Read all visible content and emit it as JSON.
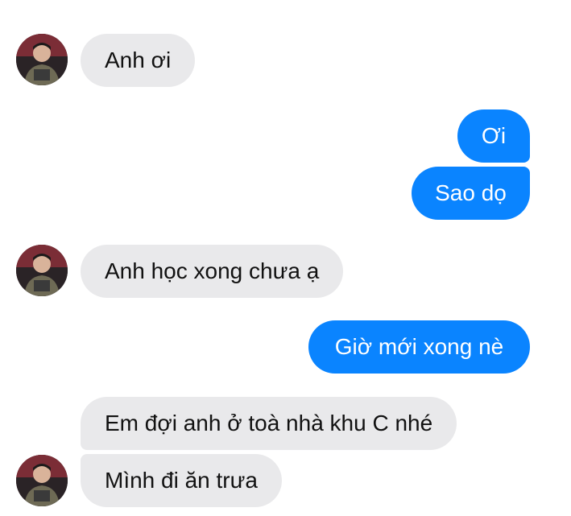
{
  "conversation": {
    "messages": [
      {
        "direction": "incoming",
        "text": "Anh ơi"
      },
      {
        "direction": "outgoing",
        "text": "Ơi"
      },
      {
        "direction": "outgoing",
        "text": "Sao dọ"
      },
      {
        "direction": "incoming",
        "text": "Anh học xong chưa ạ"
      },
      {
        "direction": "outgoing",
        "text": "Giờ mới xong nè"
      },
      {
        "direction": "incoming",
        "text": "Em đợi anh ở toà nhà khu C nhé"
      },
      {
        "direction": "incoming",
        "text": "Mình đi ăn trưa"
      }
    ]
  },
  "colors": {
    "incoming_bubble": "#e9e9eb",
    "outgoing_bubble": "#0a84ff",
    "outgoing_text": "#ffffff",
    "incoming_text": "#111111"
  },
  "icons": {
    "avatar": "contact-avatar"
  }
}
